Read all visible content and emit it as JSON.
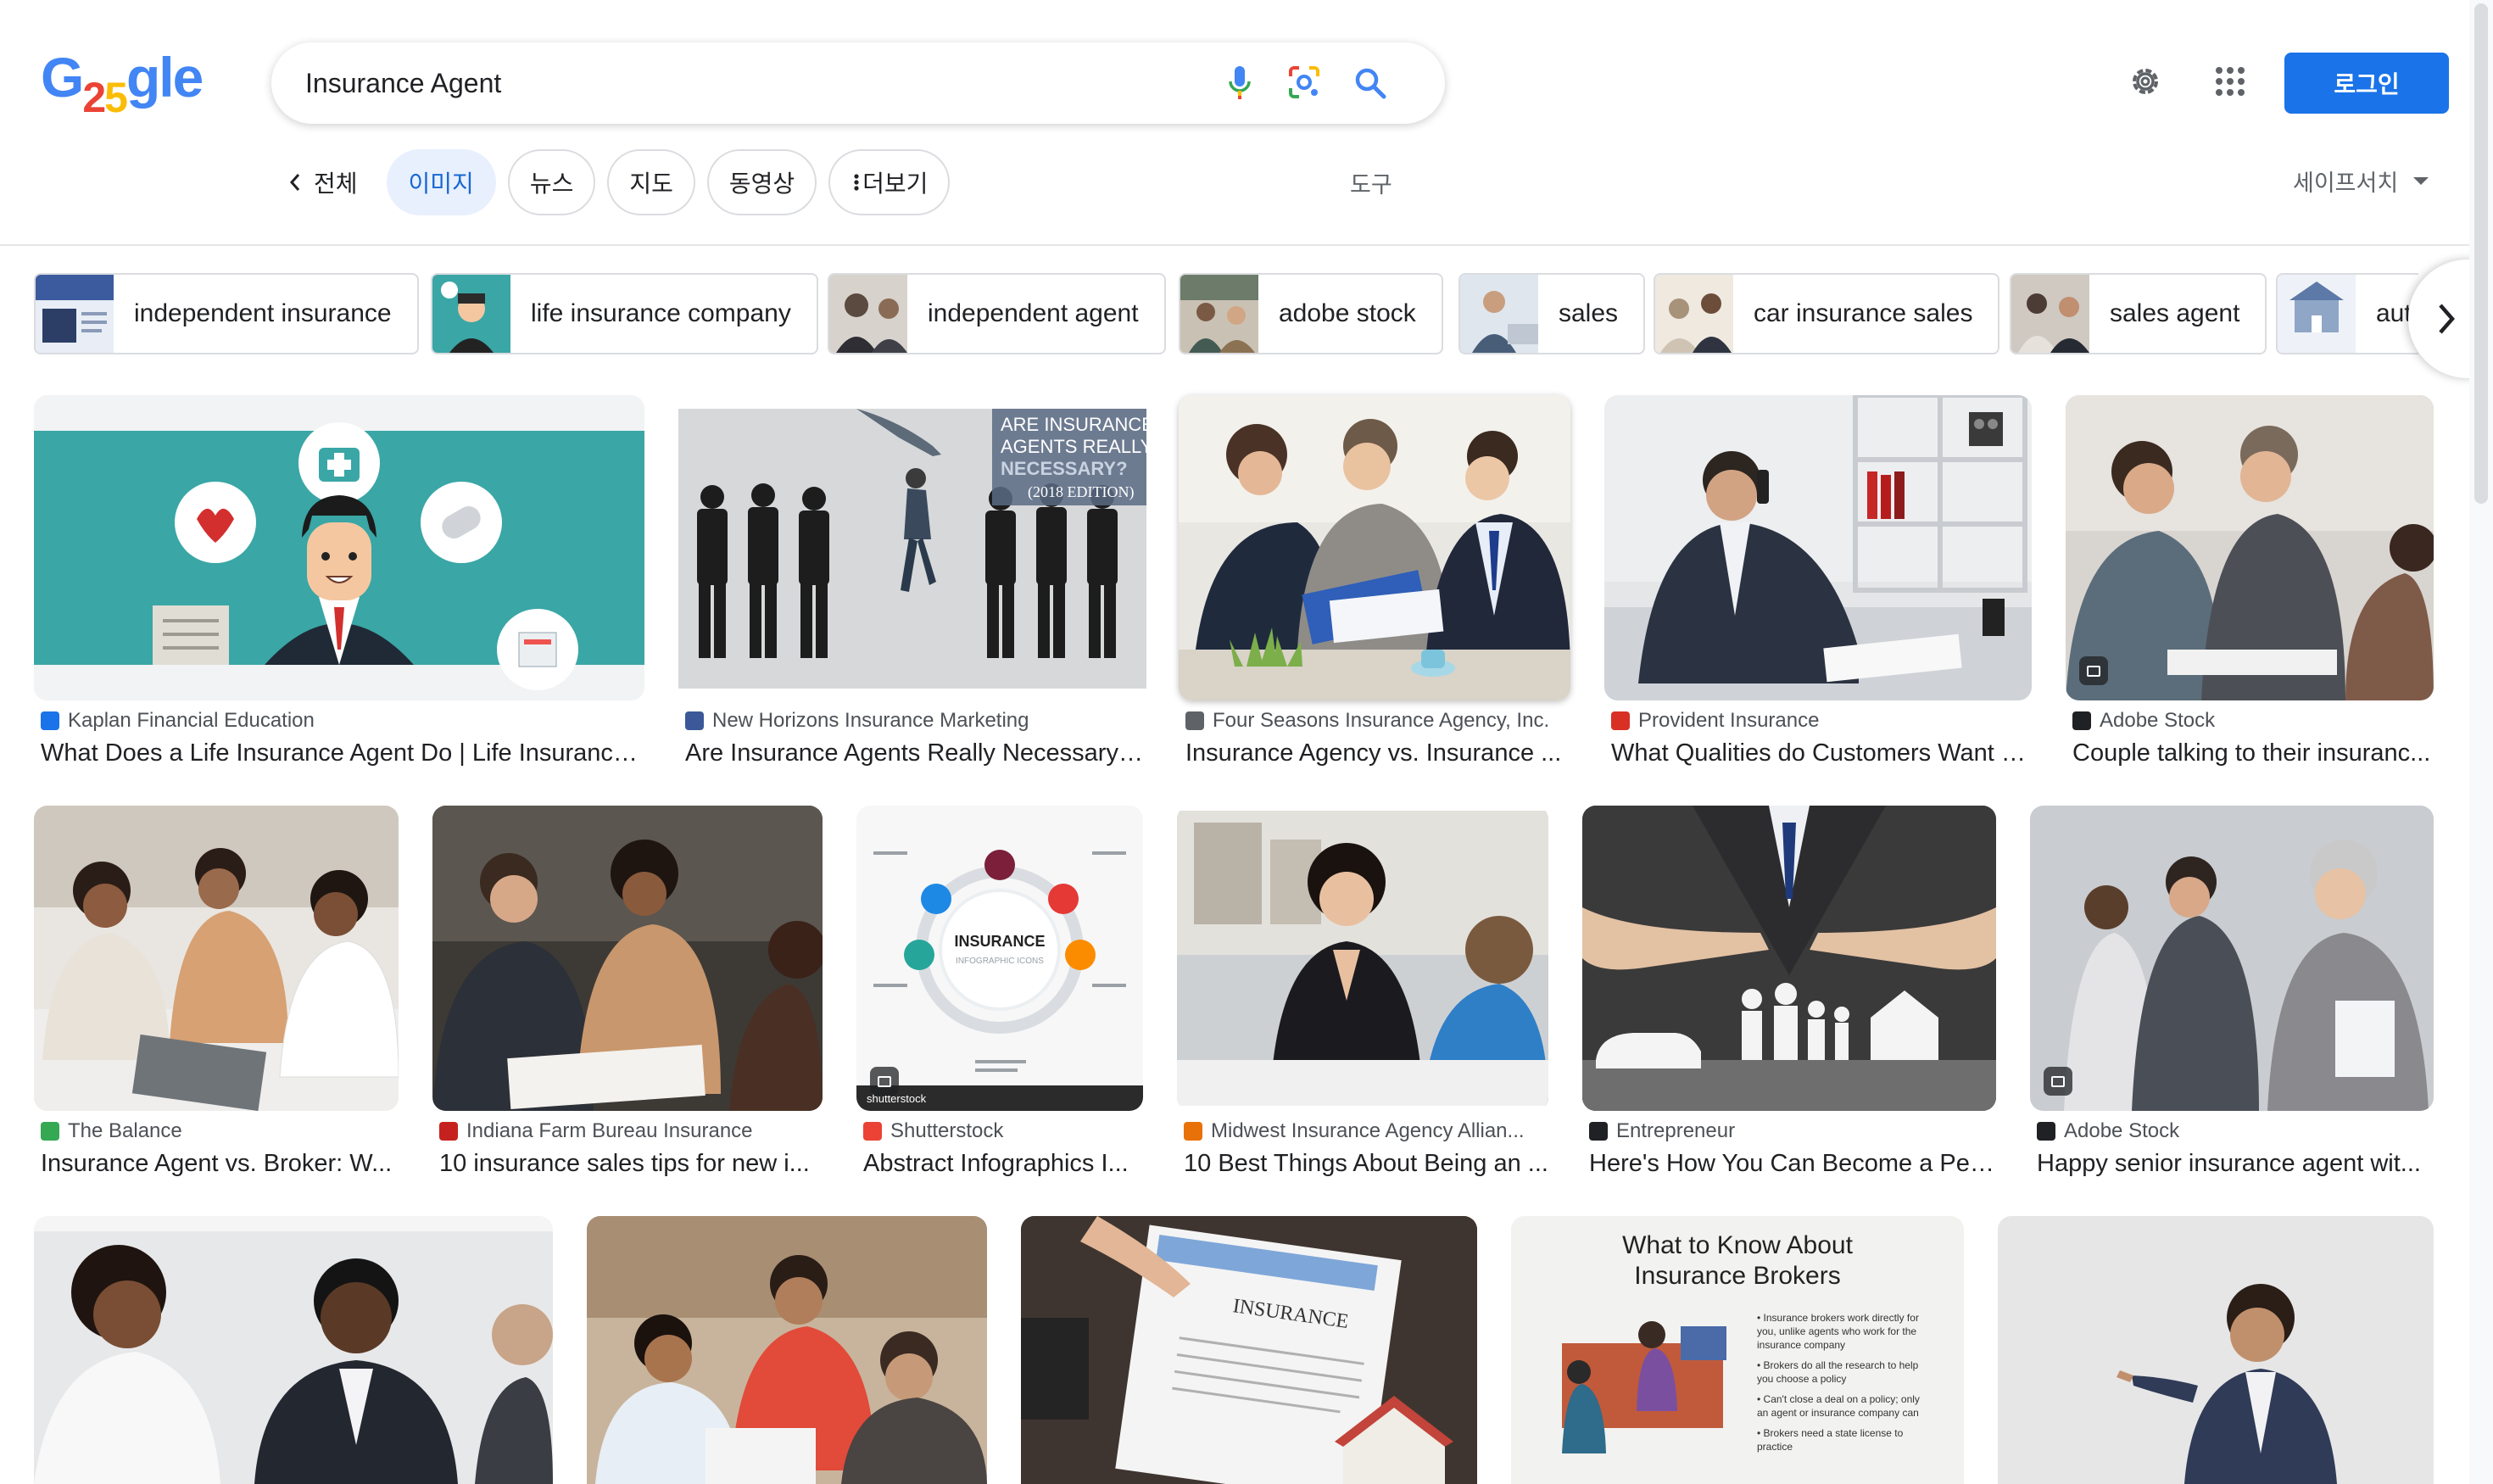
{
  "logo": {
    "letters": [
      "G",
      "2",
      "5",
      "gle"
    ]
  },
  "search": {
    "query": "Insurance Agent"
  },
  "header": {
    "login_label": "로그인",
    "settings_icon": "gear-icon",
    "apps_icon": "apps-grid-icon"
  },
  "tabs": {
    "back_label": "전체",
    "items": [
      {
        "label": "이미지",
        "active": true
      },
      {
        "label": "뉴스"
      },
      {
        "label": "지도"
      },
      {
        "label": "동영상"
      },
      {
        "label": "더보기"
      }
    ],
    "tools_label": "도구",
    "safesearch_label": "세이프서치"
  },
  "related": [
    {
      "label": "independent insurance",
      "thumb": "#3c5a9e"
    },
    {
      "label": "life insurance company",
      "thumb": "#3aa6a6"
    },
    {
      "label": "independent agent",
      "thumb": "#5b4a3f"
    },
    {
      "label": "adobe stock",
      "thumb": "#6d7b6a"
    },
    {
      "label": "sales",
      "thumb": "#485e78"
    },
    {
      "label": "car insurance sales",
      "thumb": "#a7927a"
    },
    {
      "label": "sales agent",
      "thumb": "#4b3d36"
    },
    {
      "label": "aut",
      "thumb": "#8fa6c6"
    }
  ],
  "results": [
    {
      "source": "Kaplan Financial Education",
      "title": "What Does a Life Insurance Agent Do | Life Insurance ...",
      "fav": "#1a73e8"
    },
    {
      "source": "New Horizons Insurance Marketing",
      "title": "Are Insurance Agents Really Necessary?...",
      "fav": "#3b5998",
      "overlay": [
        "ARE INSURANCE",
        "AGENTS REALLY",
        "NECESSARY?",
        "(2018 EDITION)"
      ]
    },
    {
      "source": "Four Seasons Insurance Agency, Inc.",
      "title": "Insurance Agency vs. Insurance ...",
      "fav": "#5f6368"
    },
    {
      "source": "Provident Insurance",
      "title": "What Qualities do Customers Want i...",
      "fav": "#d93025"
    },
    {
      "source": "Adobe Stock",
      "title": "Couple talking to their insuranc...",
      "fav": "#202124"
    },
    {
      "source": "The Balance",
      "title": "Insurance Agent vs. Broker: W...",
      "fav": "#34a853"
    },
    {
      "source": "Indiana Farm Bureau Insurance",
      "title": "10 insurance sales tips for new i...",
      "fav": "#c5221f"
    },
    {
      "source": "Shutterstock",
      "title": "Abstract Infographics I...",
      "fav": "#ea4335",
      "overlay": [
        "INSURANCE",
        "INFOGRAPHIC ICONS",
        "shutterstock"
      ]
    },
    {
      "source": "Midwest Insurance Agency Allian...",
      "title": "10 Best Things About Being an ...",
      "fav": "#e8710a"
    },
    {
      "source": "Entrepreneur",
      "title": "Here's How You Can Become a Per...",
      "fav": "#202124"
    },
    {
      "source": "Adobe Stock",
      "title": "Happy senior insurance agent wit...",
      "fav": "#202124"
    }
  ],
  "row3": {
    "brokers_title": [
      "What to Know About",
      "Insurance Brokers"
    ],
    "brokers_points": [
      "• Insurance brokers work directly for",
      "you, unlike agents who work for the",
      "insurance company",
      "• Brokers do all the research to help",
      "you choose a policy",
      "• Can't close a deal on a policy; only",
      "an agent or insurance company can",
      "• Brokers need a state license to",
      "practice"
    ],
    "document_word": "INSURANCE"
  }
}
